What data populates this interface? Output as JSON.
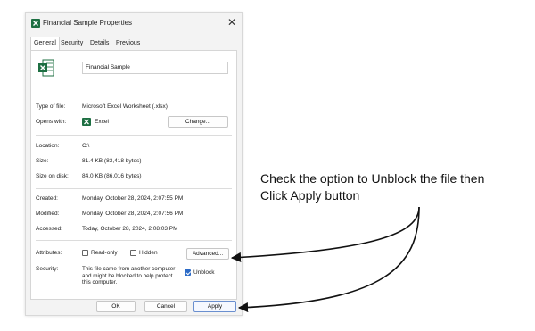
{
  "window": {
    "title": "Financial Sample Properties",
    "close_glyph": "✕"
  },
  "tabs": [
    {
      "label": "General",
      "active": true
    },
    {
      "label": "Security",
      "active": false
    },
    {
      "label": "Details",
      "active": false
    },
    {
      "label": "Previous Versions",
      "active": false
    }
  ],
  "general": {
    "file_name": "Financial Sample",
    "type_of_file": {
      "label": "Type of file:",
      "value": "Microsoft Excel Worksheet (.xlsx)"
    },
    "opens_with": {
      "label": "Opens with:",
      "value": "Excel",
      "change_button": "Change..."
    },
    "location": {
      "label": "Location:",
      "value": "C:\\"
    },
    "size": {
      "label": "Size:",
      "value": "81.4 KB (83,418 bytes)"
    },
    "size_on_disk": {
      "label": "Size on disk:",
      "value": "84.0 KB (86,016 bytes)"
    },
    "created": {
      "label": "Created:",
      "value": "Monday, October 28, 2024, 2:07:55 PM"
    },
    "modified": {
      "label": "Modified:",
      "value": "Monday, October 28, 2024, 2:07:56 PM"
    },
    "accessed": {
      "label": "Accessed:",
      "value": "Today, October 28, 2024, 2:08:03 PM"
    },
    "attributes": {
      "label": "Attributes:",
      "read_only": {
        "label": "Read-only",
        "checked": false
      },
      "hidden": {
        "label": "Hidden",
        "checked": false
      },
      "advanced_button": "Advanced..."
    },
    "security": {
      "label": "Security:",
      "message": "This file came from another computer and might be blocked to help protect this computer.",
      "unblock": {
        "label": "Unblock",
        "checked": true
      }
    }
  },
  "footer": {
    "ok": "OK",
    "cancel": "Cancel",
    "apply": "Apply"
  },
  "annotation": {
    "line1": "Check the option to Unblock the file then",
    "line2": "Click Apply button"
  },
  "colors": {
    "excel_green": "#1d6f42",
    "checkbox_blue": "#2c6bc7"
  },
  "icons": [
    "excel-file-icon",
    "excel-app-icon",
    "close-icon",
    "checkmark-icon",
    "arrow-icon"
  ]
}
